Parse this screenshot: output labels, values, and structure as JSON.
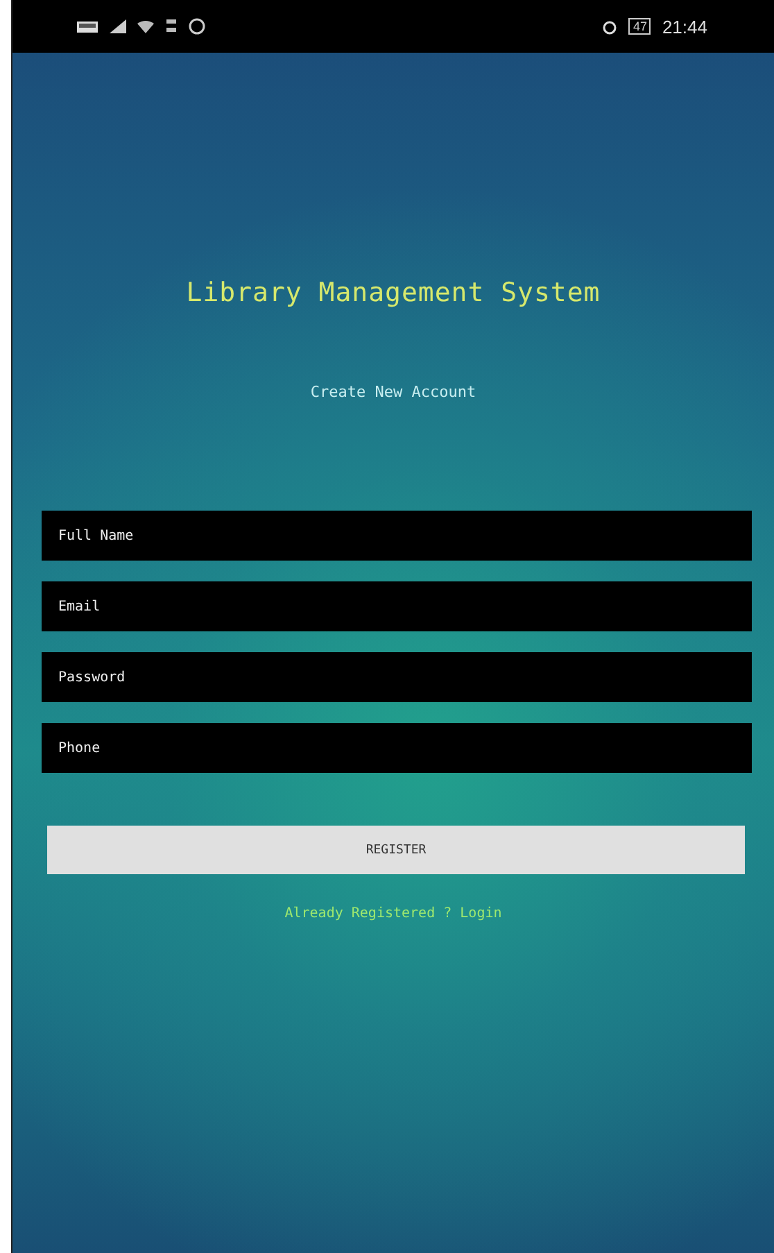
{
  "status_bar": {
    "battery": "47",
    "time": "21:44"
  },
  "title": "Library Management System",
  "subtitle": "Create New Account",
  "fields": [
    {
      "placeholder": "Full Name"
    },
    {
      "placeholder": "Email"
    },
    {
      "placeholder": "Password"
    },
    {
      "placeholder": "Phone"
    }
  ],
  "button": "REGISTER",
  "link": "Already Registered ? Login"
}
